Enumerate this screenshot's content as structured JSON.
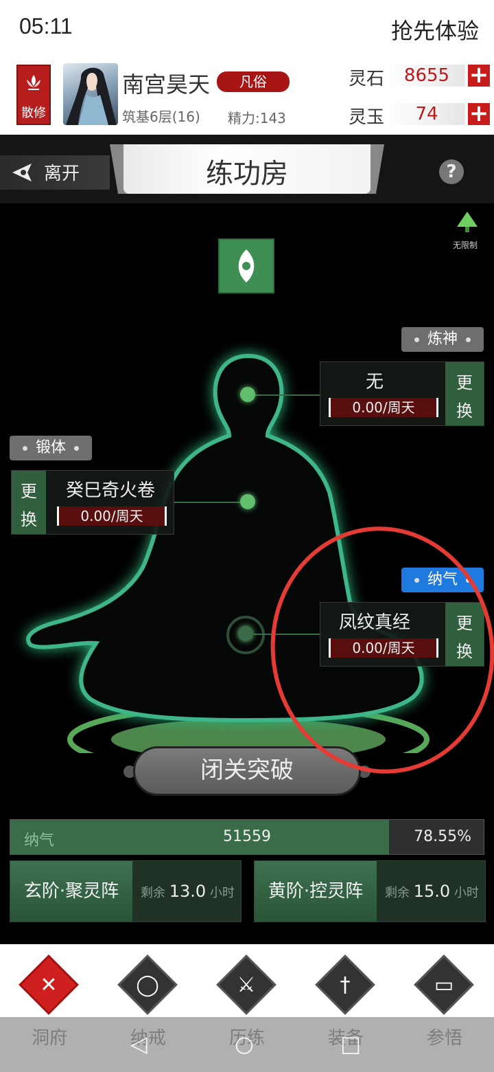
{
  "status_bar": {
    "time": "05:11",
    "right_text": "抢先体验"
  },
  "player": {
    "sect": "散修",
    "name": "南宫昊天",
    "rank": "凡俗",
    "cultivation": "筑基6层(16)",
    "energy": "精力:143"
  },
  "resources": [
    {
      "label": "灵石",
      "value": "8655"
    },
    {
      "label": "灵玉",
      "value": "74"
    }
  ],
  "titlebar": {
    "leave": "离开",
    "title": "练功房",
    "help": "?"
  },
  "scene": {
    "unlimited_label": "无限制",
    "slots": {
      "spirit": {
        "tag": "炼神",
        "name": "无",
        "rate": "0.00/周天",
        "swap": [
          "更",
          "换"
        ]
      },
      "body": {
        "tag": "锻体",
        "name": "癸巳奇火卷",
        "rate": "0.00/周天",
        "swap": [
          "更",
          "换"
        ]
      },
      "qi": {
        "tag": "纳气",
        "name": "凤纹真经",
        "rate": "0.00/周天",
        "swap": [
          "更",
          "换"
        ]
      }
    },
    "breakthrough": "闭关突破",
    "progress": {
      "label": "纳气",
      "value": "51559",
      "percent_text": "78.55%",
      "fraction": 0.8
    },
    "arrays": [
      {
        "name": "玄阶·聚灵阵",
        "remain_prefix": "剩余",
        "hours": "13.0",
        "unit": "小时"
      },
      {
        "name": "黄阶·控灵阵",
        "remain_prefix": "剩余",
        "hours": "15.0",
        "unit": "小时"
      }
    ]
  },
  "bottom_nav": [
    {
      "label": "洞府",
      "icon": "cross-icon",
      "active": true
    },
    {
      "label": "纳戒",
      "icon": "ring-icon",
      "active": false
    },
    {
      "label": "历练",
      "icon": "crossed-swords-icon",
      "active": false
    },
    {
      "label": "装备",
      "icon": "dagger-icon",
      "active": false
    },
    {
      "label": "参悟",
      "icon": "book-icon",
      "active": false
    }
  ],
  "colors": {
    "accent_red": "#c01818",
    "jade_green": "#3f8f55",
    "swap_green": "#2f5f3c",
    "annotation_red": "#e53b35"
  }
}
